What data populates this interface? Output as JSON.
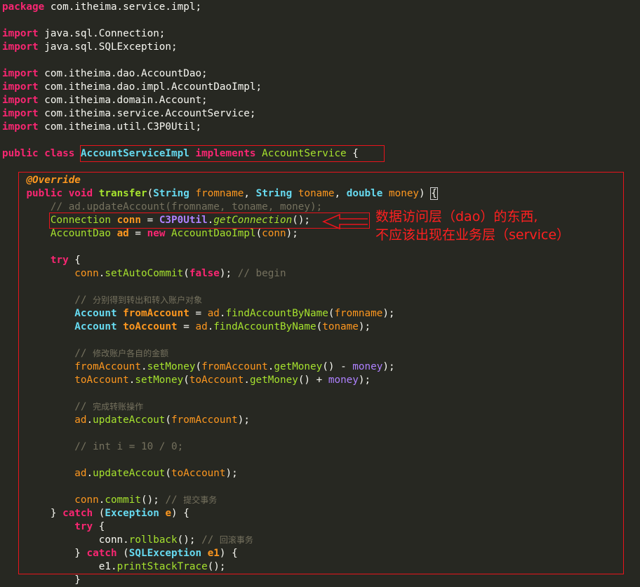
{
  "code": {
    "l1": {
      "kw": "package",
      "rest": " com.itheima.service.impl;"
    },
    "l3": {
      "kw": "import",
      "rest": " java.sql.Connection;"
    },
    "l4": {
      "kw": "import",
      "rest": " java.sql.SQLException;"
    },
    "l6": {
      "kw": "import",
      "rest": " com.itheima.dao.AccountDao;"
    },
    "l7": {
      "kw": "import",
      "rest": " com.itheima.dao.impl.AccountDaoImpl;"
    },
    "l8": {
      "kw": "import",
      "rest": " com.itheima.domain.Account;"
    },
    "l9": {
      "kw": "import",
      "rest": " com.itheima.service.AccountService;"
    },
    "l10": {
      "kw": "import",
      "rest": " com.itheima.util.C3P0Util;"
    },
    "l12": {
      "public": "public",
      "class": "class",
      "name": "AccountServiceImpl",
      "implements": "implements",
      "iface": "AccountService",
      "tail": " {"
    },
    "l14": {
      "annotation": "@Override"
    },
    "l15": {
      "public": "public",
      "void": "void",
      "name": "transfer",
      "open": "(",
      "t1": "String",
      "p1": "fromname",
      "c1": ", ",
      "t2": "String",
      "p2": "toname",
      "c2": ", ",
      "t3": "double",
      "p3": "money",
      "close": ") ",
      "brace": "{"
    },
    "l16": {
      "comment": "// ad.updateAccount(fromname, toname, money);"
    },
    "l17": {
      "type": "Connection",
      "var": "conn",
      "eq": " = ",
      "cls": "C3P0Util",
      "dot": ".",
      "m": "getConnection",
      "end": "();"
    },
    "l18": {
      "type": "AccountDao",
      "var": "ad",
      "eq": " = ",
      "new": "new",
      "ctor": "AccountDaoImpl",
      "open": "(",
      "arg": "conn",
      "end": ");"
    },
    "l20": {
      "kw": "try",
      "tail": " {"
    },
    "l21": {
      "obj": "conn",
      "dot": ".",
      "m": "setAutoCommit",
      "open": "(",
      "val": "false",
      "end": "); ",
      "comment": "// begin"
    },
    "l23": {
      "slashes": "// ",
      "text": "分别得到转出和转入账户对象"
    },
    "l24": {
      "type": "Account",
      "var": "fromAccount",
      "eq": " = ",
      "obj": "ad",
      "dot": ".",
      "m": "findAccountByName",
      "open": "(",
      "arg": "fromname",
      "end": ");"
    },
    "l25": {
      "type": "Account",
      "var": "toAccount",
      "eq": " = ",
      "obj": "ad",
      "dot": ".",
      "m": "findAccountByName",
      "open": "(",
      "arg": "toname",
      "end": ");"
    },
    "l27": {
      "slashes": "// ",
      "text": "修改账户各自的金额"
    },
    "l28": {
      "obj": "fromAccount",
      "dot": ".",
      "m": "setMoney",
      "open": "(",
      "obj2": "fromAccount",
      "dot2": ".",
      "m2": "getMoney",
      "mid": "() - ",
      "arg": "money",
      "end": ");"
    },
    "l29": {
      "obj": "toAccount",
      "dot": ".",
      "m": "setMoney",
      "open": "(",
      "obj2": "toAccount",
      "dot2": ".",
      "m2": "getMoney",
      "mid": "() + ",
      "arg": "money",
      "end": ");"
    },
    "l31": {
      "slashes": "// ",
      "text": "完成转账操作"
    },
    "l32": {
      "obj": "ad",
      "dot": ".",
      "m": "updateAccout",
      "open": "(",
      "arg": "fromAccount",
      "end": ");"
    },
    "l34": {
      "comment": "// int i = 10 / 0;"
    },
    "l36": {
      "obj": "ad",
      "dot": ".",
      "m": "updateAccout",
      "open": "(",
      "arg": "toAccount",
      "end": ");"
    },
    "l38": {
      "obj": "conn",
      "dot": ".",
      "m": "commit",
      "end": "(); ",
      "slashes": "// ",
      "text": "提交事务"
    },
    "l39": {
      "lead": "} ",
      "kw": "catch",
      "open": " (",
      "type": "Exception",
      "var": "e",
      "end": ") {"
    },
    "l40": {
      "kw": "try",
      "tail": " {"
    },
    "l41": {
      "obj": "conn",
      "dot": ".",
      "m": "rollback",
      "end": "(); ",
      "slashes": "// ",
      "text": "回滚事务"
    },
    "l42": {
      "lead": "} ",
      "kw": "catch",
      "open": " (",
      "type": "SQLException",
      "var": "e1",
      "end": ") {"
    },
    "l43": {
      "obj": "e1",
      "dot": ".",
      "m": "printStackTrace",
      "end": "();"
    },
    "l44": {
      "text": "}"
    }
  },
  "annotation_note": {
    "line1": "数据访问层（dao）的东西,",
    "line2": "不应该出现在业务层（service）"
  },
  "colors": {
    "background": "#272822",
    "keyword": "#f92672",
    "type": "#66d9ef",
    "function": "#a6e22e",
    "variable": "#fd971f",
    "constant": "#ae81ff",
    "comment": "#75715e",
    "plain": "#f8f8f2",
    "highlight": "#e8141c"
  }
}
